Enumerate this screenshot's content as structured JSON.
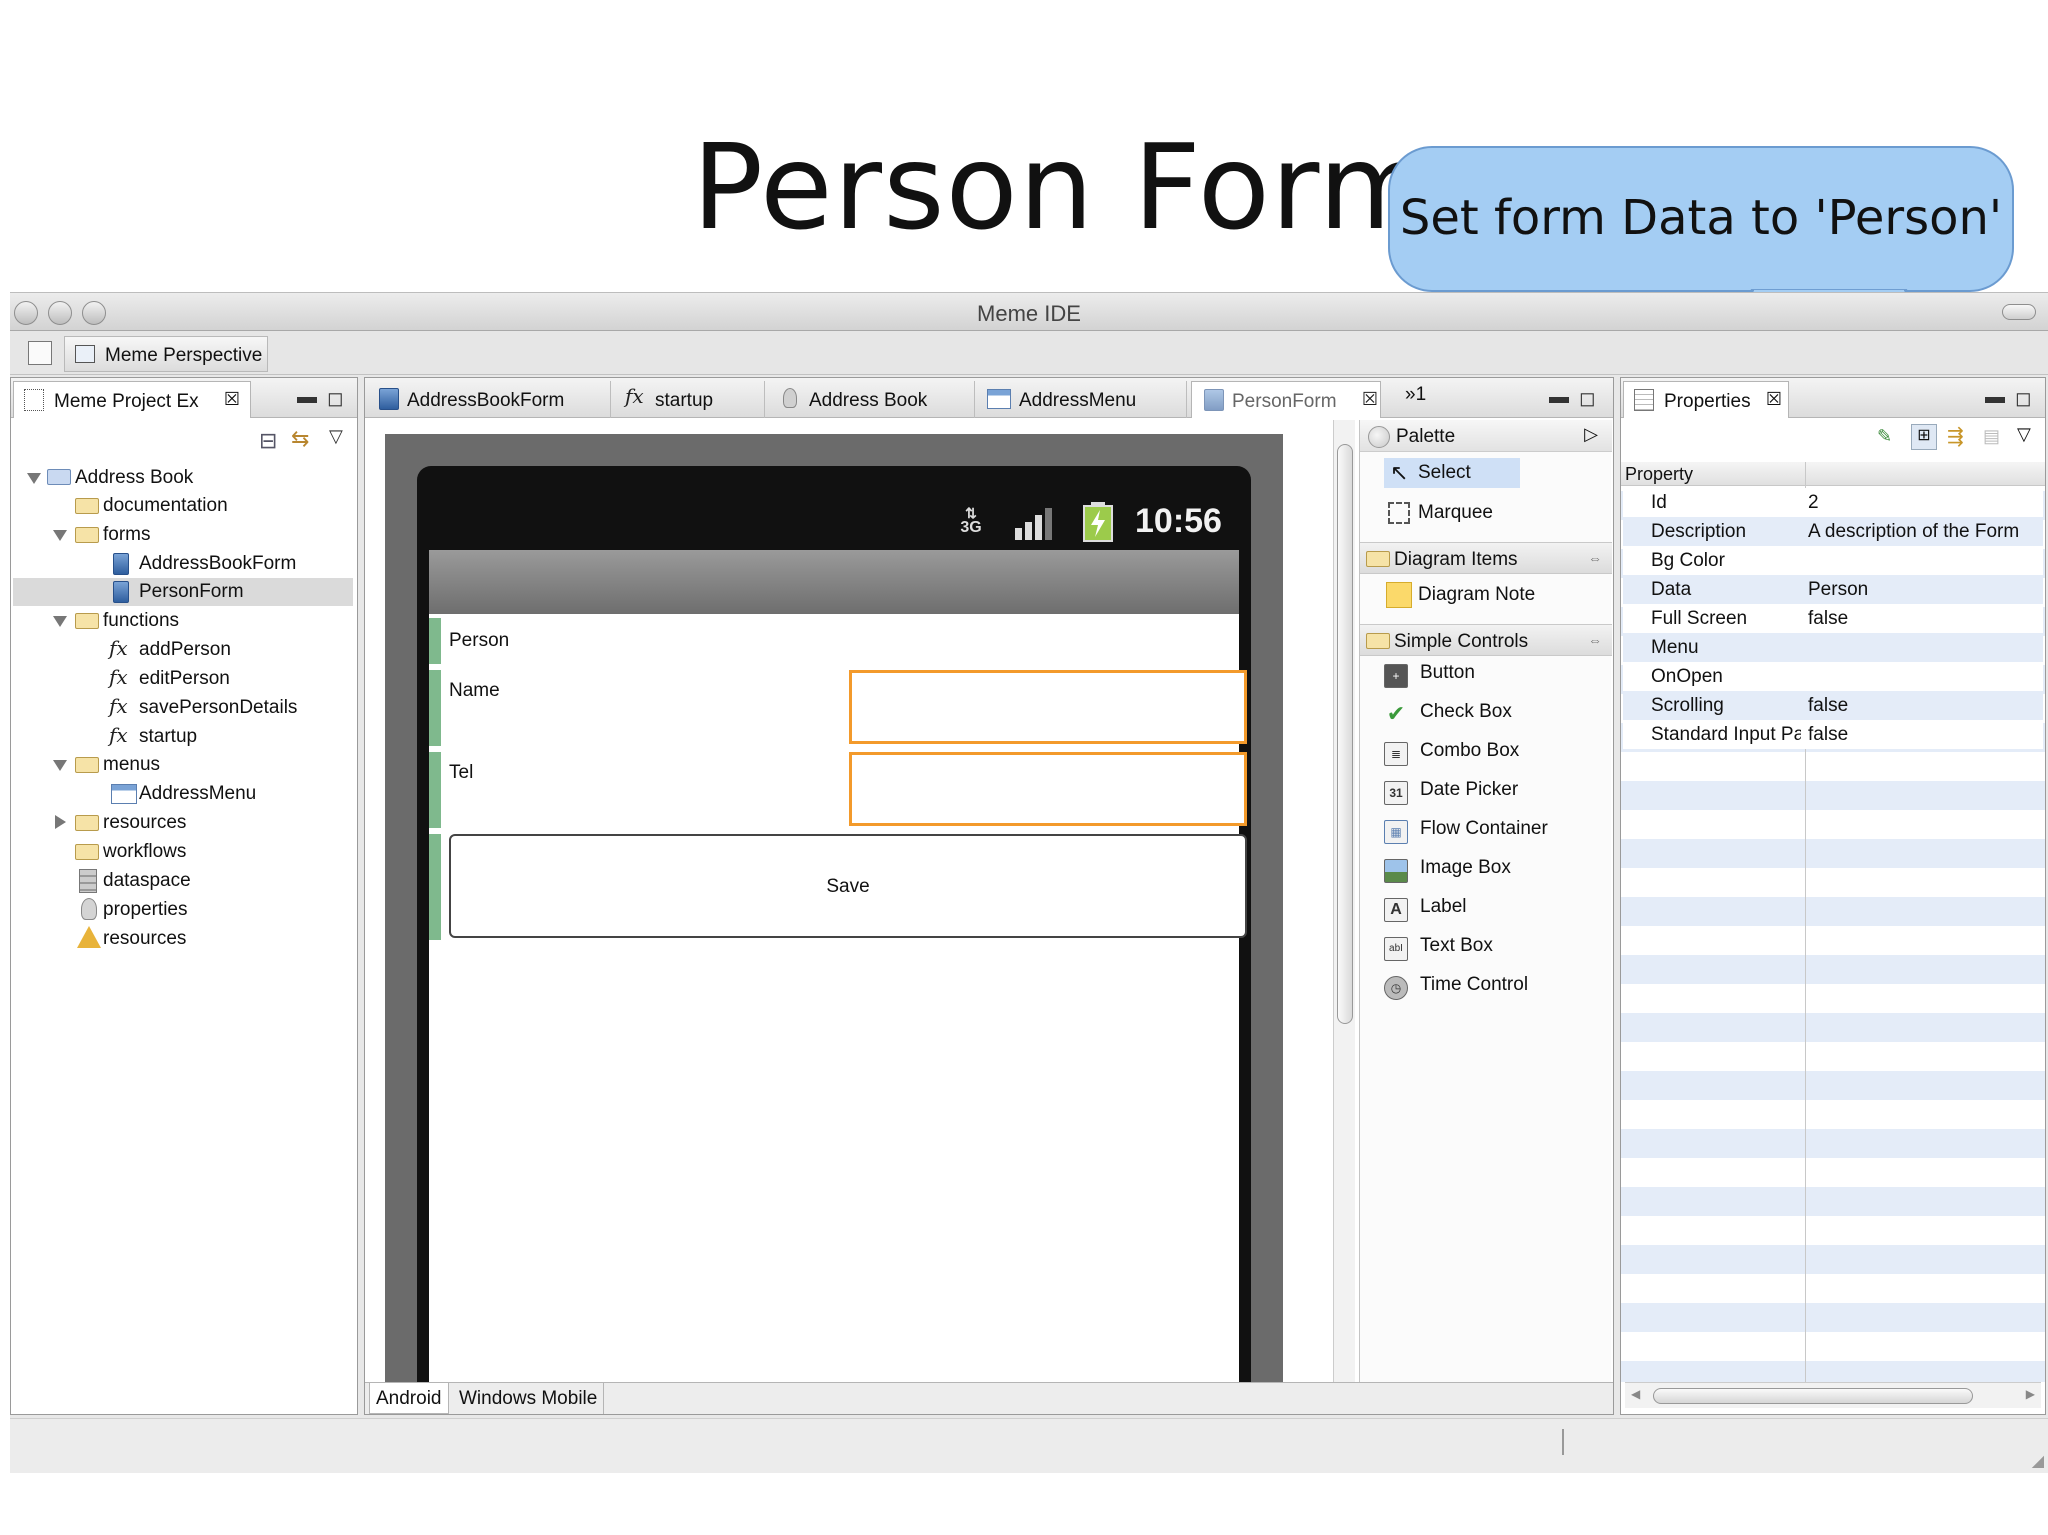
{
  "slide": {
    "title": "Person Form",
    "callout": "Set form Data to 'Person'"
  },
  "window": {
    "title": "Meme IDE"
  },
  "toolbar": {
    "perspective_label": "Meme Perspective"
  },
  "project_explorer": {
    "tab_label": "Meme Project Ex",
    "tree": [
      {
        "label": "Address Book",
        "type": "project",
        "expanded": true
      },
      {
        "label": "documentation",
        "type": "folder"
      },
      {
        "label": "forms",
        "type": "folder",
        "expanded": true
      },
      {
        "label": "AddressBookForm",
        "type": "form"
      },
      {
        "label": "PersonForm",
        "type": "form",
        "selected": true
      },
      {
        "label": "functions",
        "type": "folder",
        "expanded": true
      },
      {
        "label": "addPerson",
        "type": "function"
      },
      {
        "label": "editPerson",
        "type": "function"
      },
      {
        "label": "savePersonDetails",
        "type": "function"
      },
      {
        "label": "startup",
        "type": "function"
      },
      {
        "label": "menus",
        "type": "folder",
        "expanded": true
      },
      {
        "label": "AddressMenu",
        "type": "menu"
      },
      {
        "label": "resources",
        "type": "folder",
        "collapsed": true
      },
      {
        "label": "workflows",
        "type": "folder"
      },
      {
        "label": "dataspace",
        "type": "dataspace"
      },
      {
        "label": "properties",
        "type": "properties"
      },
      {
        "label": "resources",
        "type": "resources"
      }
    ]
  },
  "editor": {
    "tabs": [
      {
        "label": "AddressBookForm"
      },
      {
        "label": "startup"
      },
      {
        "label": "Address Book"
      },
      {
        "label": "AddressMenu"
      },
      {
        "label": "PersonForm",
        "active": true
      }
    ],
    "overflow_label": "»1",
    "phone": {
      "time": "10:56",
      "network": "3G",
      "form_title": "Person",
      "name_label": "Name",
      "tel_label": "Tel",
      "save_label": "Save"
    },
    "bottom_tabs": [
      "Android",
      "Windows Mobile"
    ]
  },
  "palette": {
    "header": "Palette",
    "tools": [
      "Select",
      "Marquee"
    ],
    "drawers": [
      {
        "label": "Diagram Items",
        "items": [
          "Diagram Note"
        ]
      },
      {
        "label": "Simple Controls",
        "items": [
          "Button",
          "Check Box",
          "Combo Box",
          "Date Picker",
          "Flow Container",
          "Image Box",
          "Label",
          "Text Box",
          "Time Control"
        ]
      }
    ]
  },
  "properties": {
    "tab_label": "Properties",
    "column_header": "Property",
    "rows": [
      {
        "name": "Id",
        "value": "2"
      },
      {
        "name": "Description",
        "value": "A description of the Form"
      },
      {
        "name": "Bg Color",
        "value": ""
      },
      {
        "name": "Data",
        "value": "Person"
      },
      {
        "name": "Full Screen",
        "value": "false"
      },
      {
        "name": "Menu",
        "value": ""
      },
      {
        "name": "OnOpen",
        "value": ""
      },
      {
        "name": "Scrolling",
        "value": "false"
      },
      {
        "name": "Standard Input Panel",
        "value": "false"
      }
    ]
  },
  "colors": {
    "callout_fill": "#a4cdf3",
    "input_border": "#f39a2b",
    "form_bar": "#7fb98d",
    "selection": "#dadada"
  }
}
